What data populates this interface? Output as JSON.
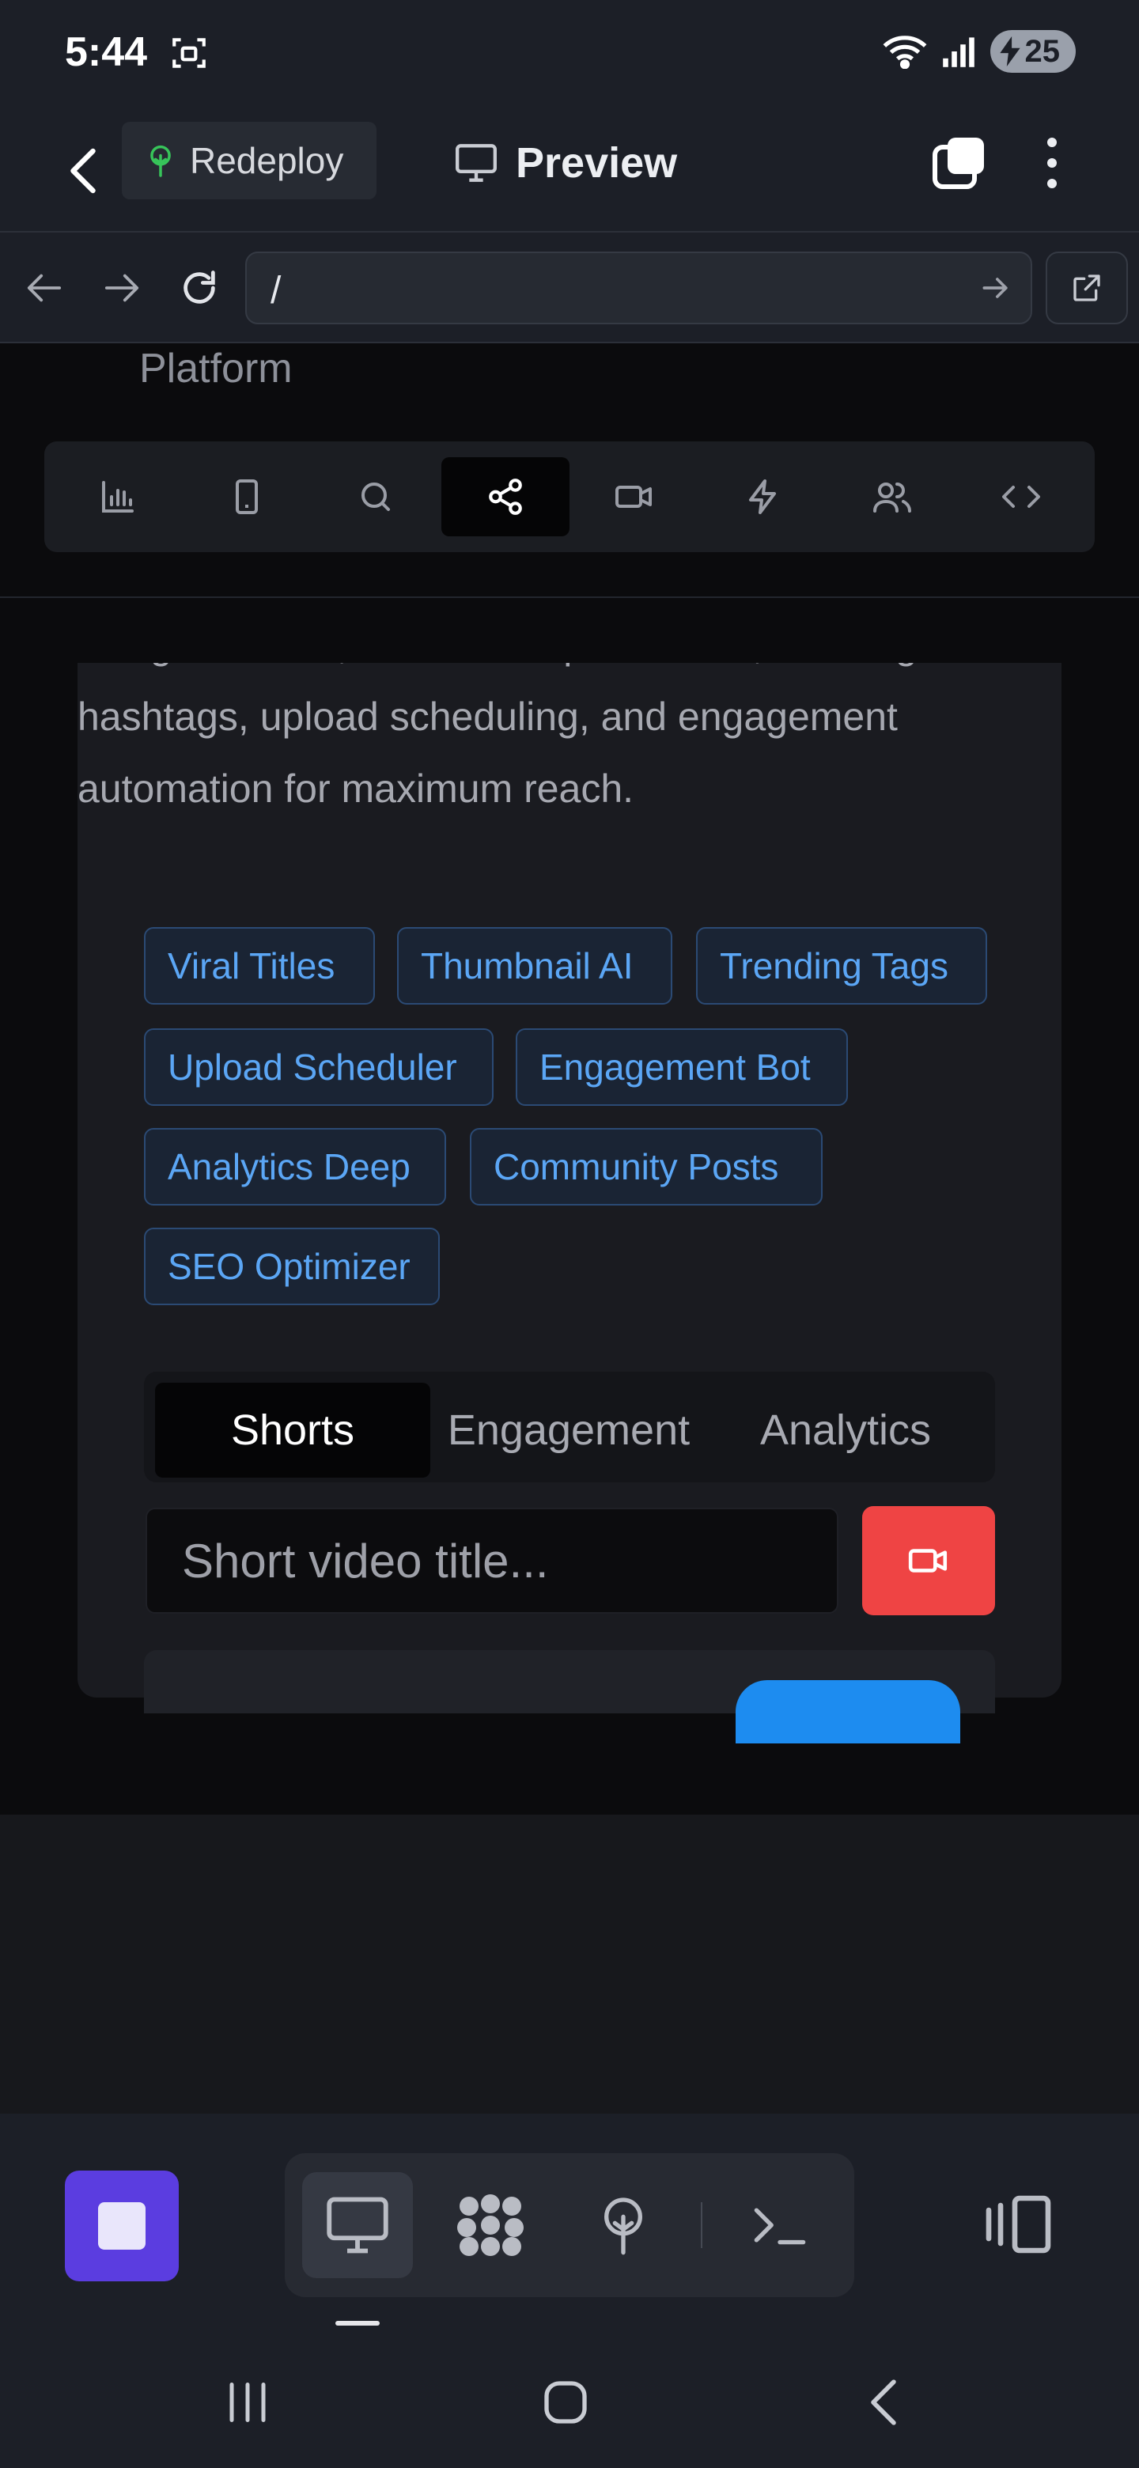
{
  "status_bar": {
    "time": "5:44",
    "battery": "25"
  },
  "header": {
    "redeploy_label": "Redeploy",
    "title": "Preview"
  },
  "browser": {
    "url": "/"
  },
  "page": {
    "platform_text": "Platform",
    "toolbar_tools": [
      "chart-icon",
      "mobile-icon",
      "search-icon",
      "share-icon",
      "video-icon",
      "lightning-icon",
      "users-icon",
      "code-icon"
    ],
    "active_tool": "share-icon",
    "description": "title generation, thumbnail optimization, trending hashtags, upload scheduling, and engagement automation for maximum reach.",
    "tags": [
      "Viral Titles",
      "Thumbnail AI",
      "Trending Tags",
      "Upload Scheduler",
      "Engagement Bot",
      "Analytics Deep",
      "Community Posts",
      "SEO Optimizer"
    ],
    "tabs": [
      "Shorts",
      "Engagement",
      "Analytics"
    ],
    "active_tab": "Shorts",
    "title_placeholder": "Short video title..."
  },
  "colors": {
    "accent": "#5b3de0",
    "record": "#ef4444",
    "tag_text": "#5ba6f5",
    "link_blue": "#1d8cf0"
  }
}
